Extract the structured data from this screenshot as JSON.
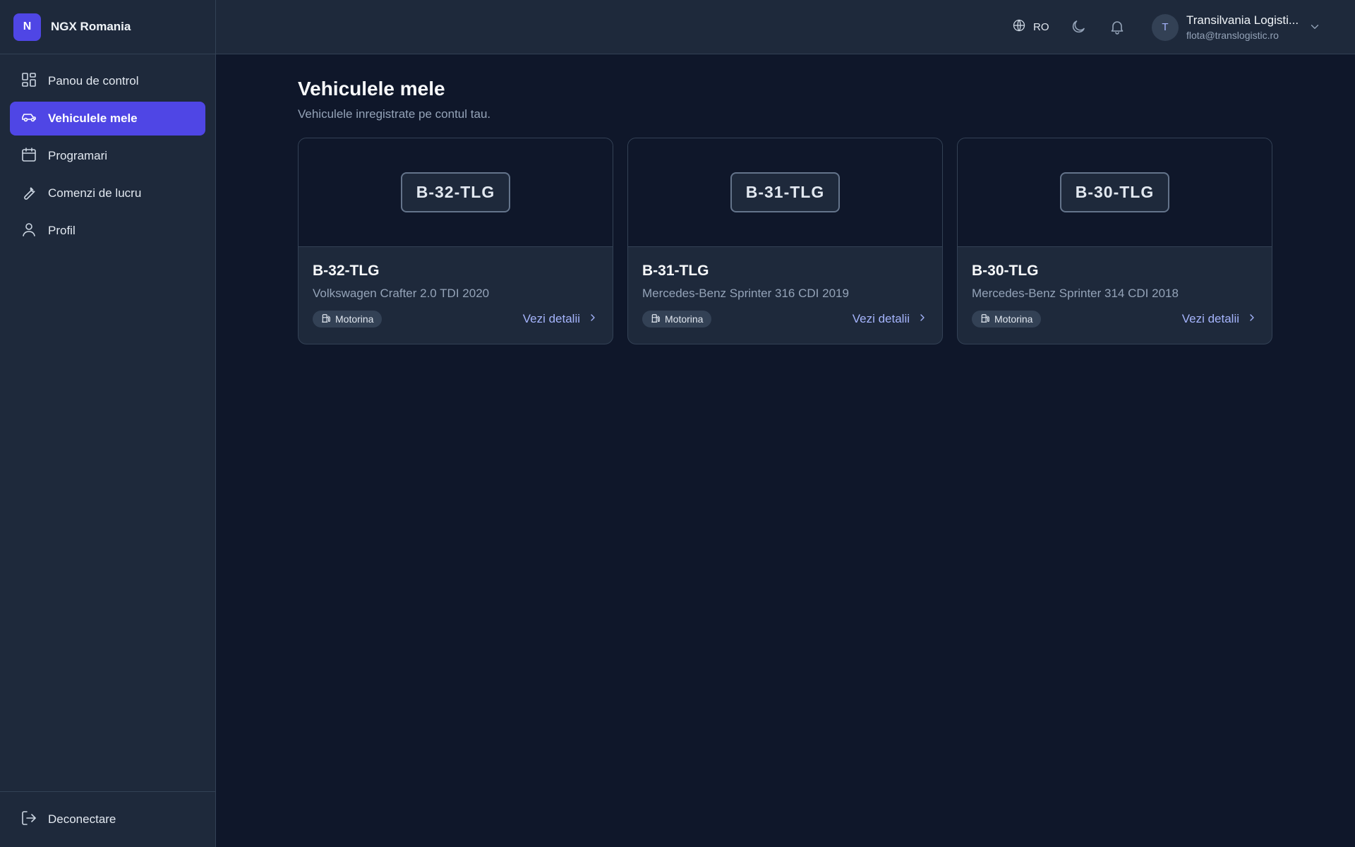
{
  "brand": {
    "logo_letter": "N",
    "name": "NGX Romania"
  },
  "sidebar": {
    "items": [
      {
        "label": "Panou de control",
        "icon": "dashboard-icon"
      },
      {
        "label": "Vehiculele mele",
        "icon": "car-icon",
        "active": true
      },
      {
        "label": "Programari",
        "icon": "calendar-icon"
      },
      {
        "label": "Comenzi de lucru",
        "icon": "wrench-icon"
      },
      {
        "label": "Profil",
        "icon": "user-icon"
      }
    ],
    "logout_label": "Deconectare"
  },
  "header": {
    "language": "RO",
    "user": {
      "initial": "T",
      "name": "Transilvania Logisti...",
      "email": "flota@translogistic.ro"
    }
  },
  "page": {
    "title": "Vehiculele mele",
    "subtitle": "Vehiculele inregistrate pe contul tau."
  },
  "vehicles": [
    {
      "plate": "B-32-TLG",
      "title": "B-32-TLG",
      "model": "Volkswagen Crafter 2.0 TDI 2020",
      "fuel": "Motorina",
      "link": "Vezi detalii"
    },
    {
      "plate": "B-31-TLG",
      "title": "B-31-TLG",
      "model": "Mercedes-Benz Sprinter 316 CDI 2019",
      "fuel": "Motorina",
      "link": "Vezi detalii"
    },
    {
      "plate": "B-30-TLG",
      "title": "B-30-TLG",
      "model": "Mercedes-Benz Sprinter 314 CDI 2018",
      "fuel": "Motorina",
      "link": "Vezi detalii"
    }
  ],
  "colors": {
    "accent": "#4f46e5",
    "link": "#a5b4fc",
    "background": "#0f172a",
    "panel": "#1e293b"
  }
}
